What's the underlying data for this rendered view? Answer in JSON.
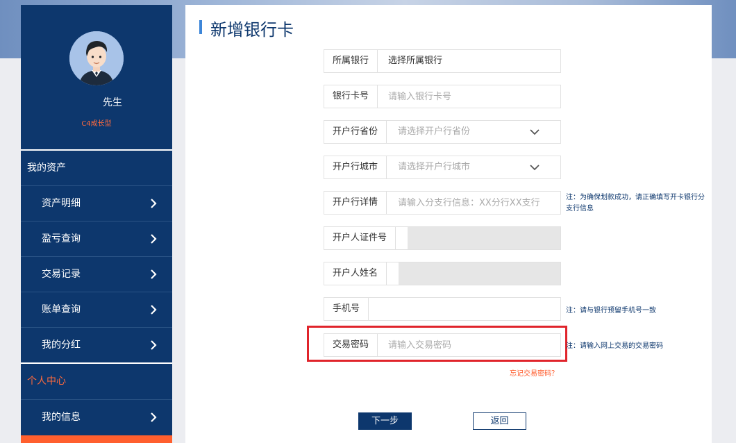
{
  "colors": {
    "navy": "#0d376d",
    "accent_orange": "#ff6a3d",
    "highlight_red": "#e0242b",
    "title_bar_blue": "#3d86d8"
  },
  "profile": {
    "name": "先生",
    "level": "C4成长型"
  },
  "sidebar": {
    "assets_title": "我的资产",
    "assets_items": [
      {
        "label": "资产明细"
      },
      {
        "label": "盈亏查询"
      },
      {
        "label": "交易记录"
      },
      {
        "label": "账单查询"
      },
      {
        "label": "我的分红"
      }
    ],
    "personal_title": "个人中心",
    "personal_items": [
      {
        "label": "我的信息"
      }
    ]
  },
  "page": {
    "title": "新增银行卡"
  },
  "form": {
    "bank": {
      "label": "所属银行",
      "value": "选择所属银行"
    },
    "card_no": {
      "label": "银行卡号",
      "placeholder": "请输入银行卡号"
    },
    "province": {
      "label": "开户行省份",
      "placeholder": "请选择开户行省份"
    },
    "city": {
      "label": "开户行城市",
      "placeholder": "请选择开户行城市"
    },
    "branch": {
      "label": "开户行详情",
      "placeholder": "请输入分支行信息：XX分行XX支行",
      "note_line1": "注：为确保划款成功，请正确填写开卡银行分",
      "note_line2": "支行信息"
    },
    "id_no": {
      "label": "开户人证件号",
      "value": ""
    },
    "holder_name": {
      "label": "开户人姓名",
      "value": ""
    },
    "phone": {
      "label": "手机号",
      "value": "",
      "note": "注：请与银行预留手机号一致"
    },
    "trade_pwd": {
      "label": "交易密码",
      "placeholder": "请输入交易密码",
      "note": "注：请输入网上交易的交易密码"
    },
    "forgot_link": "忘记交易密码？"
  },
  "buttons": {
    "next": "下一步",
    "back": "返回"
  }
}
